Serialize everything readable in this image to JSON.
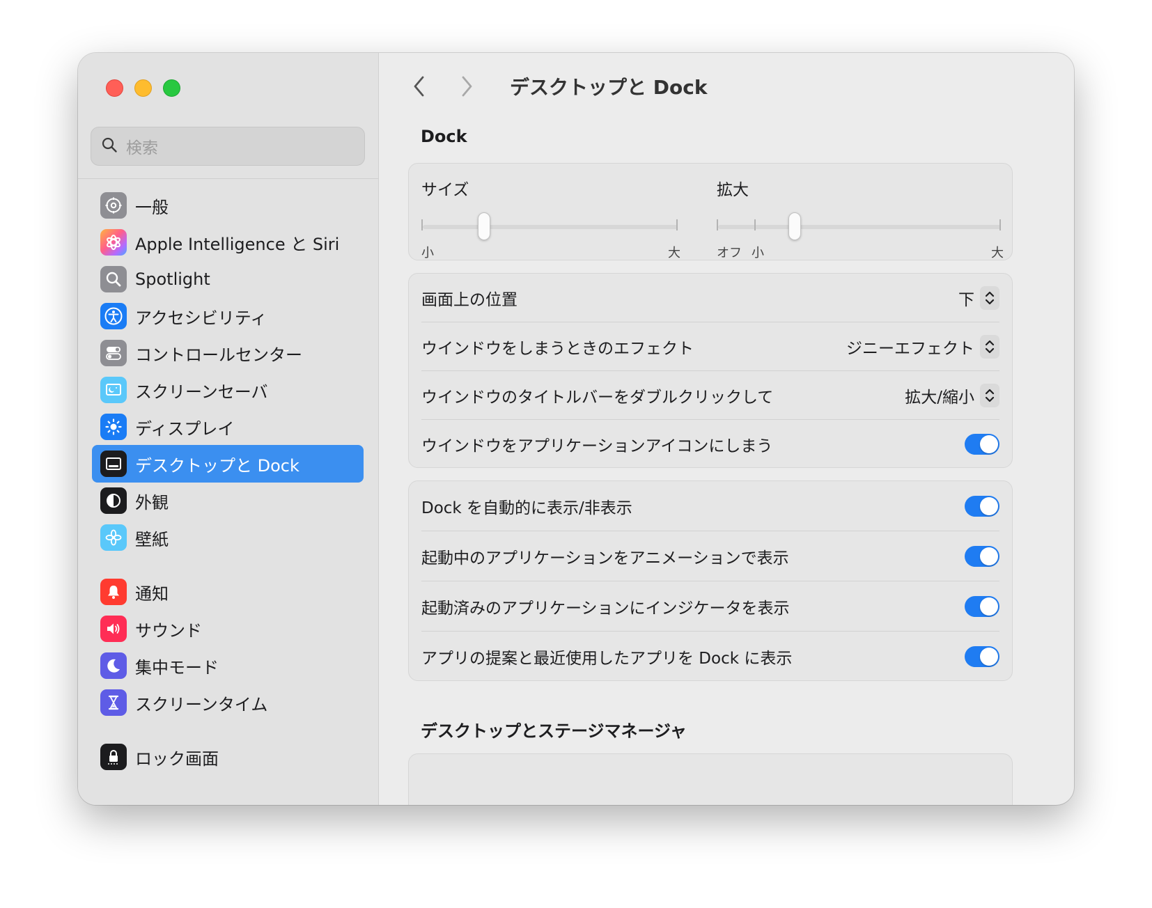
{
  "window": {
    "title": "デスクトップと Dock"
  },
  "search": {
    "placeholder": "検索"
  },
  "sidebar": {
    "items": [
      {
        "label": "一般",
        "icon": "gear-icon",
        "color": "#8e8e93"
      },
      {
        "label": "Apple Intelligence と Siri",
        "icon": "apple-intelligence-icon",
        "color": "#ff6b9a"
      },
      {
        "label": "Spotlight",
        "icon": "magnifier-icon",
        "color": "#8e8e93"
      },
      {
        "label": "アクセシビリティ",
        "icon": "accessibility-icon",
        "color": "#1a7cf5"
      },
      {
        "label": "コントロールセンター",
        "icon": "toggles-icon",
        "color": "#8e8e93"
      },
      {
        "label": "スクリーンセーバ",
        "icon": "screensaver-icon",
        "color": "#5ac8fa"
      },
      {
        "label": "ディスプレイ",
        "icon": "sun-icon",
        "color": "#1a7cf5"
      },
      {
        "label": "デスクトップと Dock",
        "icon": "dock-icon",
        "color": "#1c1c1e"
      },
      {
        "label": "外観",
        "icon": "appearance-icon",
        "color": "#1c1c1e"
      },
      {
        "label": "壁紙",
        "icon": "flower-icon",
        "color": "#5ac8fa"
      },
      {
        "label": "通知",
        "icon": "bell-icon",
        "color": "#ff3b30"
      },
      {
        "label": "サウンド",
        "icon": "speaker-icon",
        "color": "#ff2d55"
      },
      {
        "label": "集中モード",
        "icon": "moon-icon",
        "color": "#5e5ce6"
      },
      {
        "label": "スクリーンタイム",
        "icon": "hourglass-icon",
        "color": "#5e5ce6"
      },
      {
        "label": "ロック画面",
        "icon": "lock-icon",
        "color": "#1c1c1e"
      }
    ],
    "selected_index": 7
  },
  "main": {
    "title": "デスクトップと Dock",
    "dock_section": "Dock",
    "size_slider": {
      "label": "サイズ",
      "min_label": "小",
      "max_label": "大",
      "value": 0.24
    },
    "magnify_slider": {
      "label": "拡大",
      "off_label": "オフ",
      "min_label": "小",
      "max_label": "大",
      "value": 0.27
    },
    "group1": [
      {
        "label": "画面上の位置",
        "type": "popup",
        "value": "下"
      },
      {
        "label": "ウインドウをしまうときのエフェクト",
        "type": "popup",
        "value": "ジニーエフェクト"
      },
      {
        "label": "ウインドウのタイトルバーをダブルクリックして",
        "type": "popup",
        "value": "拡大/縮小"
      },
      {
        "label": "ウインドウをアプリケーションアイコンにしまう",
        "type": "toggle",
        "value": true
      }
    ],
    "group2": [
      {
        "label": "Dock を自動的に表示/非表示",
        "type": "toggle",
        "value": true
      },
      {
        "label": "起動中のアプリケーションをアニメーションで表示",
        "type": "toggle",
        "value": true
      },
      {
        "label": "起動済みのアプリケーションにインジケータを表示",
        "type": "toggle",
        "value": true
      },
      {
        "label": "アプリの提案と最近使用したアプリを Dock に表示",
        "type": "toggle",
        "value": true
      }
    ],
    "desktop_section": "デスクトップとステージマネージャ"
  },
  "colors": {
    "accent": "#1f7cf2",
    "selection": "#3b8ff0"
  }
}
